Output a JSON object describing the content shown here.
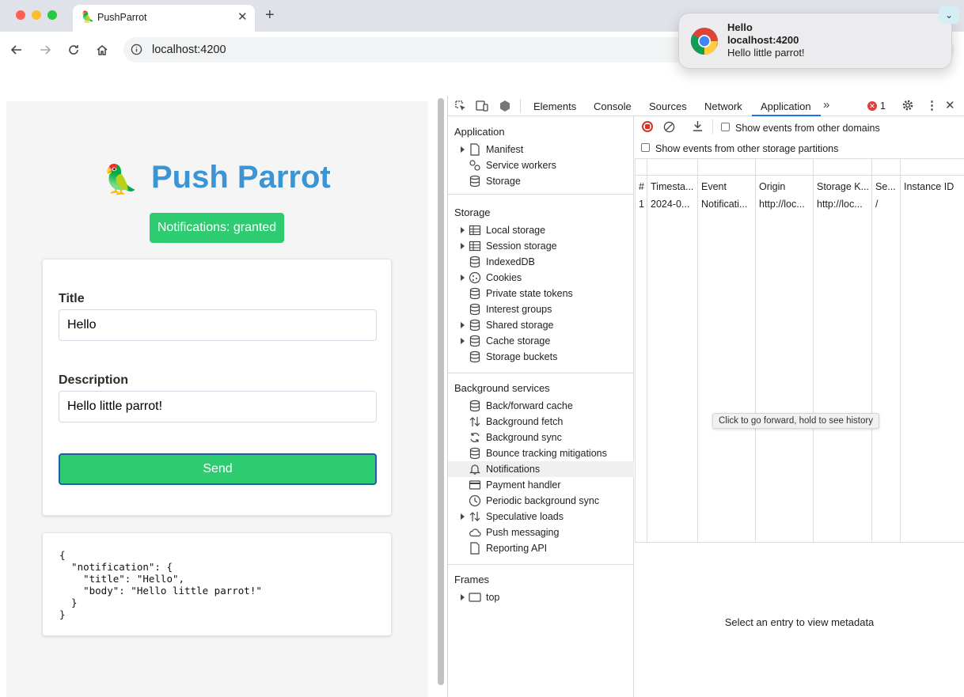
{
  "browser": {
    "tab_title": "PushParrot",
    "url": "localhost:4200"
  },
  "notification_popup": {
    "title": "Hello",
    "origin": "localhost:4200",
    "body": "Hello little parrot!"
  },
  "page": {
    "brand": "Push Parrot",
    "status_badge": "Notifications: granted",
    "title_label": "Title",
    "title_value": "Hello",
    "description_label": "Description",
    "description_value": "Hello little parrot!",
    "send_label": "Send",
    "payload_lines": [
      "{",
      "  \"notification\": {",
      "    \"title\": \"Hello\",",
      "    \"body\": \"Hello little parrot!\"",
      "  }",
      "}"
    ]
  },
  "devtools": {
    "tabs": [
      "Elements",
      "Console",
      "Sources",
      "Network",
      "Application"
    ],
    "active_tab": "Application",
    "error_count": "1",
    "sidebar": {
      "application_header": "Application",
      "application_items": [
        "Manifest",
        "Service workers",
        "Storage"
      ],
      "storage_header": "Storage",
      "storage_items": [
        "Local storage",
        "Session storage",
        "IndexedDB",
        "Cookies",
        "Private state tokens",
        "Interest groups",
        "Shared storage",
        "Cache storage",
        "Storage buckets"
      ],
      "background_header": "Background services",
      "background_items": [
        "Back/forward cache",
        "Background fetch",
        "Background sync",
        "Bounce tracking mitigations",
        "Notifications",
        "Payment handler",
        "Periodic background sync",
        "Speculative loads",
        "Push messaging",
        "Reporting API"
      ],
      "frames_header": "Frames",
      "frames_items": [
        "top"
      ]
    },
    "main": {
      "checkbox_other_domains": "Show events from other domains",
      "checkbox_other_partitions": "Show events from other storage partitions",
      "columns": [
        "#",
        "Timesta...",
        "Event",
        "Origin",
        "Storage K...",
        "Se...",
        "Instance ID"
      ],
      "row": [
        "1",
        "2024-0...",
        "Notificati...",
        "http://loc...",
        "http://loc...",
        "/",
        ""
      ],
      "tooltip": "Click to go forward, hold to see history",
      "empty_metadata": "Select an entry to view metadata"
    }
  },
  "colors": {
    "brand_blue": "#3b95d4",
    "green": "#2ecc71",
    "tab_strip": "#dfe3e9"
  }
}
